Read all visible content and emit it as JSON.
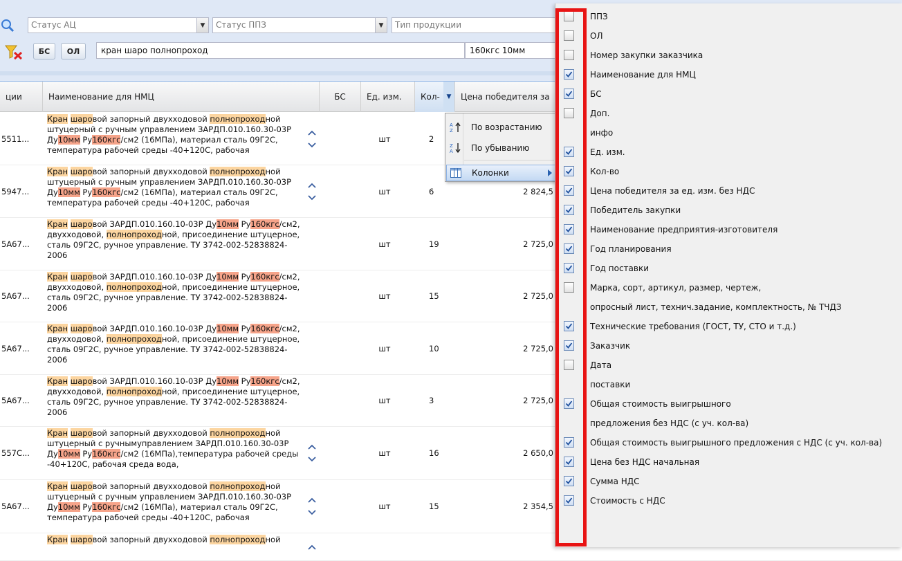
{
  "filters": {
    "status_ac": "Статус АЦ",
    "status_ppz": "Статус ППЗ",
    "product_type": "Тип продукции",
    "btn_bs": "БС",
    "btn_ol": "ОЛ",
    "search_query": "кран шаро полнопроход",
    "search_param": "160кгс 10мм"
  },
  "grid": {
    "headers": {
      "code": "ции",
      "name": "Наименование для НМЦ",
      "bs": "БС",
      "unit": "Ед. изм.",
      "qty": "Кол-",
      "price": "Цена победителя за"
    },
    "rows": [
      {
        "code": "5511...",
        "name_parts": [
          [
            "Кран",
            "hl1"
          ],
          [
            " ",
            ""
          ],
          [
            "шаро",
            "hl1"
          ],
          [
            "вой запорный двухходовой ",
            ""
          ],
          [
            "полнопроход",
            "hl1"
          ],
          [
            "ной штуцерный с ручным управлением ЗАРДП.010.160.30-03Р Ду",
            ""
          ],
          [
            "10мм",
            "hl2"
          ],
          [
            " Ру",
            ""
          ],
          [
            "160кгс",
            "hl2"
          ],
          [
            "/см2 (16МПа), материал сталь 09Г2С, температура рабочей среды -40+120С, рабочая",
            ""
          ]
        ],
        "unit": "шт",
        "qty": "2",
        "price": ""
      },
      {
        "code": "5947...",
        "name_parts": [
          [
            "Кран",
            "hl1"
          ],
          [
            " ",
            ""
          ],
          [
            "шаро",
            "hl1"
          ],
          [
            "вой запорный двухходовой ",
            ""
          ],
          [
            "полнопроход",
            "hl1"
          ],
          [
            "ной штуцерный с ручным управлением ЗАРДП.010.160.30-03Р Ду",
            ""
          ],
          [
            "10мм",
            "hl2"
          ],
          [
            " Ру",
            ""
          ],
          [
            "160кгс",
            "hl2"
          ],
          [
            "/см2 (16МПа), материал сталь 09Г2С, температура рабочей среды -40+120С, рабочая",
            ""
          ]
        ],
        "unit": "шт",
        "qty": "6",
        "price": "2 824,5"
      },
      {
        "code": "5A67...",
        "name_parts": [
          [
            "Кран",
            "hl1"
          ],
          [
            " ",
            ""
          ],
          [
            "шаро",
            "hl1"
          ],
          [
            "вой ЗАРДП.010.160.10-03Р Ду",
            ""
          ],
          [
            "10мм",
            "hl2"
          ],
          [
            " Ру",
            ""
          ],
          [
            "160кгс",
            "hl2"
          ],
          [
            "/см2, двухходовой, ",
            ""
          ],
          [
            "полнопроход",
            "hl1"
          ],
          [
            "ной, присоединение штуцерное, сталь 09Г2С, ручное управление. ТУ 3742-002-52838824-2006",
            ""
          ]
        ],
        "unit": "шт",
        "qty": "19",
        "price": "2 725,0"
      },
      {
        "code": "5A67...",
        "name_parts": [
          [
            "Кран",
            "hl1"
          ],
          [
            " ",
            ""
          ],
          [
            "шаро",
            "hl1"
          ],
          [
            "вой ЗАРДП.010.160.10-03Р Ду",
            ""
          ],
          [
            "10мм",
            "hl2"
          ],
          [
            " Ру",
            ""
          ],
          [
            "160кгс",
            "hl2"
          ],
          [
            "/см2, двухходовой, ",
            ""
          ],
          [
            "полнопроход",
            "hl1"
          ],
          [
            "ной, присоединение штуцерное, сталь 09Г2С, ручное управление. ТУ 3742-002-52838824-2006",
            ""
          ]
        ],
        "unit": "шт",
        "qty": "15",
        "price": "2 725,0"
      },
      {
        "code": "5A67...",
        "name_parts": [
          [
            "Кран",
            "hl1"
          ],
          [
            " ",
            ""
          ],
          [
            "шаро",
            "hl1"
          ],
          [
            "вой ЗАРДП.010.160.10-03Р Ду",
            ""
          ],
          [
            "10мм",
            "hl2"
          ],
          [
            " Ру",
            ""
          ],
          [
            "160кгс",
            "hl2"
          ],
          [
            "/см2, двухходовой, ",
            ""
          ],
          [
            "полнопроход",
            "hl1"
          ],
          [
            "ной, присоединение штуцерное, сталь 09Г2С, ручное управление. ТУ 3742-002-52838824-2006",
            ""
          ]
        ],
        "unit": "шт",
        "qty": "10",
        "price": "2 725,0"
      },
      {
        "code": "5A67...",
        "name_parts": [
          [
            "Кран",
            "hl1"
          ],
          [
            " ",
            ""
          ],
          [
            "шаро",
            "hl1"
          ],
          [
            "вой ЗАРДП.010.160.10-03Р Ду",
            ""
          ],
          [
            "10мм",
            "hl2"
          ],
          [
            " Ру",
            ""
          ],
          [
            "160кгс",
            "hl2"
          ],
          [
            "/см2, двухходовой, ",
            ""
          ],
          [
            "полнопроход",
            "hl1"
          ],
          [
            "ной, присоединение штуцерное, сталь 09Г2С, ручное управление. ТУ 3742-002-52838824-2006",
            ""
          ]
        ],
        "unit": "шт",
        "qty": "3",
        "price": "2 725,0"
      },
      {
        "code": "557C...",
        "name_parts": [
          [
            "Кран",
            "hl1"
          ],
          [
            " ",
            ""
          ],
          [
            "шаро",
            "hl1"
          ],
          [
            "вой запорный двухходовой ",
            ""
          ],
          [
            "полнопроход",
            "hl1"
          ],
          [
            "ной штуцерный с ручнымуправлением ЗАРДП.010.160.30-03Р Ду",
            ""
          ],
          [
            "10мм",
            "hl2"
          ],
          [
            " Ру",
            ""
          ],
          [
            "160кгс",
            "hl2"
          ],
          [
            "/см2 (16МПа),температура рабочей среды -40+120С, рабочая среда вода,",
            ""
          ]
        ],
        "unit": "шт",
        "qty": "16",
        "price": "2 650,0"
      },
      {
        "code": "5A67...",
        "name_parts": [
          [
            "Кран",
            "hl1"
          ],
          [
            " ",
            ""
          ],
          [
            "шаро",
            "hl1"
          ],
          [
            "вой запорный двухходовой ",
            ""
          ],
          [
            "полнопроход",
            "hl1"
          ],
          [
            "ной штуцерный с ручным управлением ЗАРДП.010.160.30-03Р Ду",
            ""
          ],
          [
            "10мм",
            "hl2"
          ],
          [
            " Ру",
            ""
          ],
          [
            "160кгс",
            "hl2"
          ],
          [
            "/см2 (16МПа), материал сталь 09Г2С, температура рабочей среды -40+120С, рабочая",
            ""
          ]
        ],
        "unit": "шт",
        "qty": "15",
        "price": "2 354,5"
      },
      {
        "code": "",
        "name_parts": [
          [
            "Кран",
            "hl1"
          ],
          [
            " ",
            ""
          ],
          [
            "шаро",
            "hl1"
          ],
          [
            "вой запорный двухходовой ",
            ""
          ],
          [
            "полнопроход",
            "hl1"
          ],
          [
            "ной",
            ""
          ]
        ],
        "unit": "",
        "qty": "",
        "price": ""
      }
    ]
  },
  "sort_menu": {
    "asc": "По возрастанию",
    "desc": "По убыванию",
    "columns": "Колонки"
  },
  "columns_panel": {
    "items": [
      {
        "lines": [
          "ППЗ"
        ],
        "checked": false
      },
      {
        "lines": [
          "ОЛ"
        ],
        "checked": false
      },
      {
        "lines": [
          "Номер закупки заказчика"
        ],
        "checked": false
      },
      {
        "lines": [
          "Наименование для НМЦ"
        ],
        "checked": true
      },
      {
        "lines": [
          "БС"
        ],
        "checked": true
      },
      {
        "lines": [
          "Доп.",
          "инфо"
        ],
        "checked": false
      },
      {
        "lines": [
          "Ед. изм."
        ],
        "checked": true
      },
      {
        "lines": [
          "Кол-во"
        ],
        "checked": true
      },
      {
        "lines": [
          "Цена победителя за ед. изм. без НДС"
        ],
        "checked": true
      },
      {
        "lines": [
          "Победитель закупки"
        ],
        "checked": true
      },
      {
        "lines": [
          "Наименование предприятия-изготовителя"
        ],
        "checked": true
      },
      {
        "lines": [
          "Год планирования"
        ],
        "checked": true
      },
      {
        "lines": [
          "Год поставки"
        ],
        "checked": true
      },
      {
        "lines": [
          "Марка, сорт, артикул, размер, чертеж,",
          "опросный лист, технич.задание, комплектность, № ТЧДЗ"
        ],
        "checked": false
      },
      {
        "lines": [
          "Технические требования (ГОСТ, ТУ, СТО и т.д.)"
        ],
        "checked": true
      },
      {
        "lines": [
          "Заказчик"
        ],
        "checked": true
      },
      {
        "lines": [
          "Дата",
          "поставки"
        ],
        "checked": false
      },
      {
        "lines": [
          "Общая стоимость выигрышного",
          "предложения без НДС (с уч. кол-ва)"
        ],
        "checked": true
      },
      {
        "lines": [
          "Общая стоимость выигрышного предложения с НДС (с уч. кол-ва)"
        ],
        "checked": true
      },
      {
        "lines": [
          "Цена без НДС начальная"
        ],
        "checked": true
      },
      {
        "lines": [
          "Сумма НДС"
        ],
        "checked": true
      },
      {
        "lines": [
          "Стоимость с НДС"
        ],
        "checked": true
      }
    ]
  },
  "colors": {
    "highlight_light": "#fcd5a0",
    "highlight_strong": "#f6a48a",
    "callout_red": "#e81414",
    "toolbar_bg": "#dfe8f6"
  }
}
